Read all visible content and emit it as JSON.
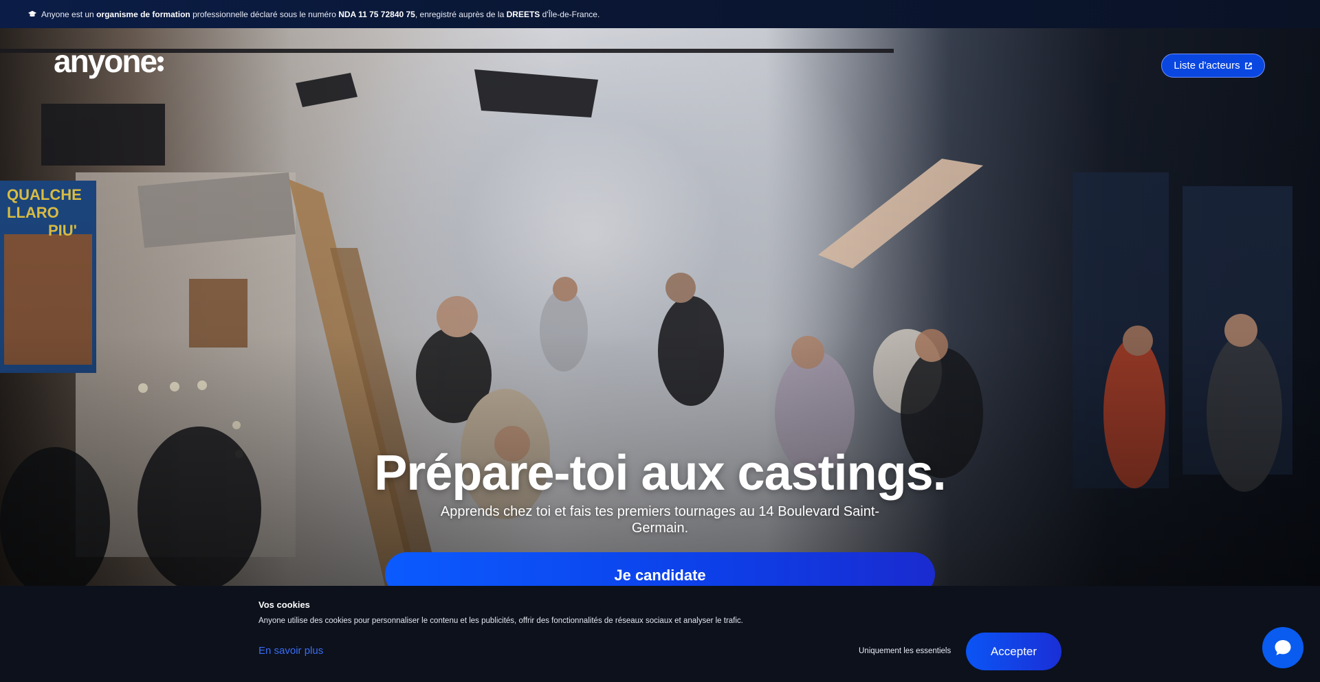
{
  "banner": {
    "icon": "graduation-cap-icon",
    "part1": "Anyone est un ",
    "bold1": "organisme de formation",
    "part2": " professionnelle déclaré sous le numéro ",
    "bold2": "NDA 11 75 72840 75",
    "part3": ", enregistré auprès de la ",
    "bold3": "DREETS",
    "part4": " d'Île-de-France."
  },
  "header": {
    "logo": "anyone",
    "actors_button": "Liste d'acteurs",
    "actors_icon": "external-link-icon"
  },
  "hero": {
    "headline": "Prépare-toi aux castings.",
    "subline": "Apprends chez toi et fais tes premiers tournages au 14 Boulevard Saint-Germain.",
    "cta": "Je candidate",
    "poster_text": "QUALCHE\nLLARO\nPIU'"
  },
  "cookies": {
    "title": "Vos cookies",
    "description": "Anyone utilise des cookies pour personnaliser le contenu et les publicités, offrir des fonctionnalités de réseaux sociaux et analyser le trafic.",
    "learn_more": "En savoir plus",
    "essentials": "Uniquement les essentiels",
    "accept": "Accepter"
  },
  "chat": {
    "icon": "chat-bubble-icon"
  },
  "colors": {
    "accent": "#0b55f5",
    "banner": "#0b1d47",
    "cookie_bg": "#0c111c"
  }
}
